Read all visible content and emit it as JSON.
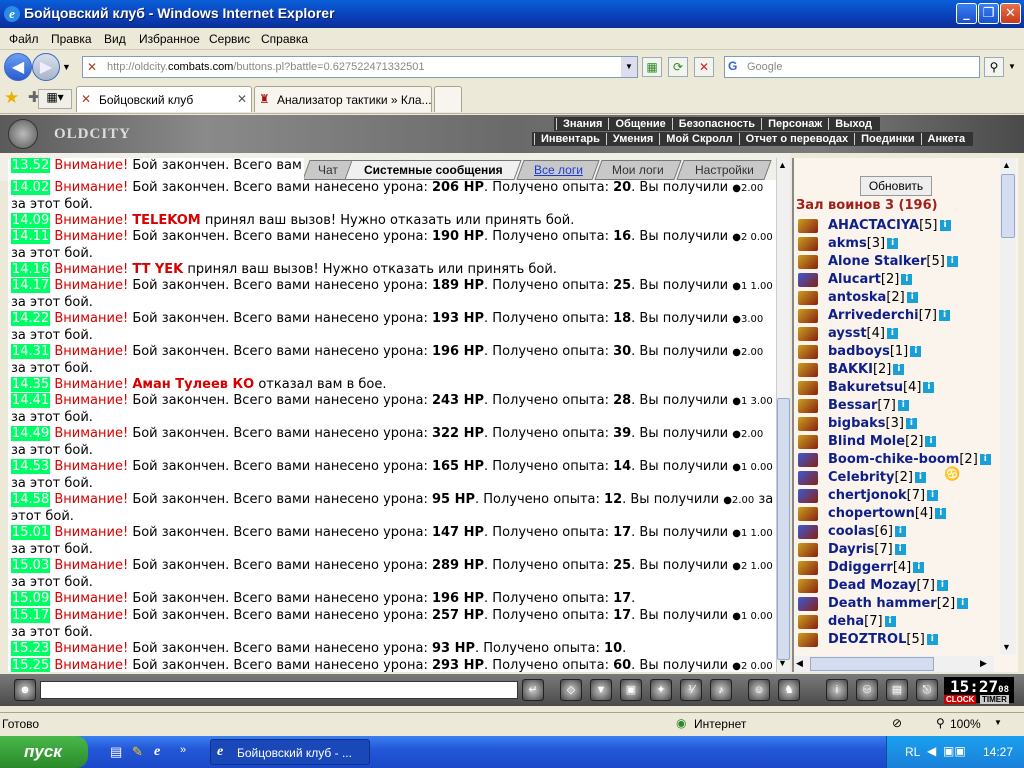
{
  "window": {
    "title": "Бойцовский клуб - Windows Internet Explorer"
  },
  "menu": [
    "Файл",
    "Правка",
    "Вид",
    "Избранное",
    "Сервис",
    "Справка"
  ],
  "address": {
    "prefix": "http://oldcity.",
    "domain": "combats.com",
    "path": "/buttons.pl?battle=0.627522471332501"
  },
  "search": {
    "placeholder": "Google"
  },
  "tabs": [
    {
      "label": "Бойцовский клуб"
    },
    {
      "label": "Анализатор тактики » Кла..."
    }
  ],
  "game": {
    "logo": "OLDCITY",
    "nav_top": [
      "Знания",
      "Общение",
      "Безопасность",
      "Персонаж",
      "Выход"
    ],
    "nav_bottom": [
      "Инвентарь",
      "Умения",
      "Мой Скролл",
      "Отчет о переводах",
      "Поединки",
      "Анкета"
    ],
    "chat_tabs": [
      "Чат",
      "Системные сообщения",
      "Все логи",
      "Мои логи",
      "Настройки"
    ]
  },
  "chat": {
    "partial_first": {
      "time": "13.52",
      "warn": "Внимание!",
      "text": "Бой закончен. Всего вам"
    },
    "messages": [
      {
        "time": "14.02",
        "warn": "Внимание!",
        "a": "Бой закончен. Всего вами нанесено урона: ",
        "hp": "206 HP",
        "b": ". Получено опыта: ",
        "xp": "20",
        "c": ". Вы получили ",
        "coin": "2.00",
        "d": " за этот бой."
      },
      {
        "time": "14.09",
        "warn": "Внимание!",
        "nick": "TELEKOM",
        "e": " принял ваш вызов! Нужно отказать или принять бой."
      },
      {
        "time": "14.11",
        "warn": "Внимание!",
        "a": "Бой закончен. Всего вами нанесено урона: ",
        "hp": "190 HP",
        "b": ". Получено опыта: ",
        "xp": "16",
        "c": ". Вы получили ",
        "coin": "2 0.00",
        "d": " за этот бой."
      },
      {
        "time": "14.16",
        "warn": "Внимание!",
        "nick": "TT YEK",
        "e": " принял ваш вызов! Нужно отказать или принять бой."
      },
      {
        "time": "14.17",
        "warn": "Внимание!",
        "a": "Бой закончен. Всего вами нанесено урона: ",
        "hp": "189 HP",
        "b": ". Получено опыта: ",
        "xp": "25",
        "c": ". Вы получили ",
        "coin": "1 1.00",
        "d": " за этот бой."
      },
      {
        "time": "14.22",
        "warn": "Внимание!",
        "a": "Бой закончен. Всего вами нанесено урона: ",
        "hp": "193 HP",
        "b": ". Получено опыта: ",
        "xp": "18",
        "c": ". Вы получили ",
        "coin": "3.00",
        "d": " за этот бой."
      },
      {
        "time": "14.31",
        "warn": "Внимание!",
        "a": "Бой закончен. Всего вами нанесено урона: ",
        "hp": "196 HP",
        "b": ". Получено опыта: ",
        "xp": "30",
        "c": ". Вы получили ",
        "coin": "2.00",
        "d": " за этот бой."
      },
      {
        "time": "14.35",
        "warn": "Внимание!",
        "nick": "Аман Тулеев КО",
        "e": " отказал вам в бое."
      },
      {
        "time": "14.41",
        "warn": "Внимание!",
        "a": "Бой закончен. Всего вами нанесено урона: ",
        "hp": "243 HP",
        "b": ". Получено опыта: ",
        "xp": "28",
        "c": ". Вы получили ",
        "coin": "1 3.00",
        "d": " за этот бой."
      },
      {
        "time": "14.49",
        "warn": "Внимание!",
        "a": "Бой закончен. Всего вами нанесено урона: ",
        "hp": "322 HP",
        "b": ". Получено опыта: ",
        "xp": "39",
        "c": ". Вы получили ",
        "coin": "2.00",
        "d": " за этот бой."
      },
      {
        "time": "14.53",
        "warn": "Внимание!",
        "a": "Бой закончен. Всего вами нанесено урона: ",
        "hp": "165 HP",
        "b": ". Получено опыта: ",
        "xp": "14",
        "c": ". Вы получили ",
        "coin": "1 0.00",
        "d": " за этот бой."
      },
      {
        "time": "14.58",
        "warn": "Внимание!",
        "a": "Бой закончен. Всего вами нанесено урона: ",
        "hp": "95 HP",
        "b": ". Получено опыта: ",
        "xp": "12",
        "c": ". Вы получили ",
        "coin": "2.00",
        "d": " за этот бой."
      },
      {
        "time": "15.01",
        "warn": "Внимание!",
        "a": "Бой закончен. Всего вами нанесено урона: ",
        "hp": "147 HP",
        "b": ". Получено опыта: ",
        "xp": "17",
        "c": ". Вы получили ",
        "coin": "1 1.00",
        "d": " за этот бой."
      },
      {
        "time": "15.03",
        "warn": "Внимание!",
        "a": "Бой закончен. Всего вами нанесено урона: ",
        "hp": "289 HP",
        "b": ". Получено опыта: ",
        "xp": "25",
        "c": ". Вы получили ",
        "coin": "2 1.00",
        "d": " за этот бой."
      },
      {
        "time": "15.09",
        "warn": "Внимание!",
        "a": "Бой закончен. Всего вами нанесено урона: ",
        "hp": "196 HP",
        "b": ". Получено опыта: ",
        "xp": "17",
        "c": "",
        "coin": "",
        "d": "."
      },
      {
        "time": "15.17",
        "warn": "Внимание!",
        "a": "Бой закончен. Всего вами нанесено урона: ",
        "hp": "257 HP",
        "b": ". Получено опыта: ",
        "xp": "17",
        "c": ". Вы получили ",
        "coin": "1 0.00",
        "d": " за этот бой."
      },
      {
        "time": "15.23",
        "warn": "Внимание!",
        "a": "Бой закончен. Всего вами нанесено урона: ",
        "hp": "93 HP",
        "b": ". Получено опыта: ",
        "xp": "10",
        "c": "",
        "coin": "",
        "d": "."
      },
      {
        "time": "15.25",
        "warn": "Внимание!",
        "a": "Бой закончен. Всего вами нанесено урона: ",
        "hp": "293 HP",
        "b": ". Получено опыта: ",
        "xp": "60",
        "c": ". Вы получили ",
        "coin": "2 0.00",
        "d": " за этот бой."
      }
    ]
  },
  "room": {
    "refresh_label": "Обновить",
    "title": "Зал воинов 3 (196)",
    "users": [
      {
        "name": "AHACTACIYA",
        "level": "[5]",
        "type": "a"
      },
      {
        "name": "akms",
        "level": "[3]",
        "type": "a"
      },
      {
        "name": "Alone Stalker",
        "level": "[5]",
        "type": "a"
      },
      {
        "name": "Alucart",
        "level": "[2]",
        "type": "b"
      },
      {
        "name": "antoska",
        "level": "[2]",
        "type": "a"
      },
      {
        "name": "Arrivederchi",
        "level": "[7]",
        "type": "a"
      },
      {
        "name": "aysst",
        "level": "[4]",
        "type": "a"
      },
      {
        "name": "badboys",
        "level": "[1]",
        "type": "a"
      },
      {
        "name": "BAKKI",
        "level": "[2]",
        "type": "a"
      },
      {
        "name": "Bakuretsu",
        "level": "[4]",
        "type": "a"
      },
      {
        "name": "Bessar",
        "level": "[7]",
        "type": "a"
      },
      {
        "name": "bigbaks",
        "level": "[3]",
        "type": "a"
      },
      {
        "name": "Blind Mole",
        "level": "[2]",
        "type": "a"
      },
      {
        "name": "Boom-chike-boom",
        "level": "[2]",
        "type": "b"
      },
      {
        "name": "Celebrity",
        "level": "[2]",
        "type": "b"
      },
      {
        "name": "chertjonok",
        "level": "[7]",
        "type": "b"
      },
      {
        "name": "chopertown",
        "level": "[4]",
        "type": "a"
      },
      {
        "name": "coolas",
        "level": "[6]",
        "type": "b"
      },
      {
        "name": "Dayris",
        "level": "[7]",
        "type": "a"
      },
      {
        "name": "Ddiggerr",
        "level": "[4]",
        "type": "a"
      },
      {
        "name": "Dead Mozay",
        "level": "[7]",
        "type": "a"
      },
      {
        "name": "Death hammer",
        "level": "[2]",
        "type": "b"
      },
      {
        "name": "deha",
        "level": "[7]",
        "type": "a"
      },
      {
        "name": "DEOZTROL",
        "level": "[5]",
        "type": "a"
      }
    ]
  },
  "clock": {
    "time": "15:27",
    "sec": "08",
    "clock_label": "CLOCK",
    "timer_label": "TIMER"
  },
  "status": {
    "text": "Готово",
    "zone": "Интернет",
    "zoom": "100%"
  },
  "taskbar": {
    "start": "пуск",
    "task": "Бойцовский клуб - ...",
    "lang": "RL",
    "time": "14:27"
  }
}
